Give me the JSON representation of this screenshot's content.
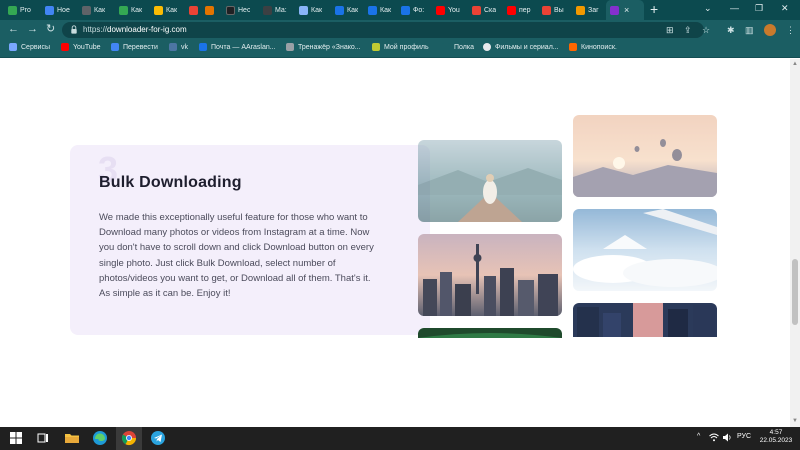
{
  "browser": {
    "tabs": [
      {
        "label": "Pro",
        "color": "#34a853"
      },
      {
        "label": "Hoe",
        "color": "#4285f4"
      },
      {
        "label": "Как",
        "color": "#5f6368"
      },
      {
        "label": "Как",
        "color": "#34a853"
      },
      {
        "label": "Как",
        "color": "#fbbc04"
      },
      {
        "label": "",
        "color": "#ea4335"
      },
      {
        "label": "",
        "color": "#e37400"
      },
      {
        "label": "Hec",
        "color": "#202124"
      },
      {
        "label": "Ма:",
        "color": "#3c4043"
      },
      {
        "label": "Как",
        "color": "#8ab4f8"
      },
      {
        "label": "Как",
        "color": "#1a73e8"
      },
      {
        "label": "Как",
        "color": "#1a73e8"
      },
      {
        "label": "Фо:",
        "color": "#1a73e8"
      },
      {
        "label": "You",
        "color": "#ff0000"
      },
      {
        "label": "Ска",
        "color": "#ea4335"
      },
      {
        "label": "пер",
        "color": "#ff0000"
      },
      {
        "label": "Вы",
        "color": "#ea4335"
      },
      {
        "label": "Заг",
        "color": "#f29900"
      },
      {
        "label": "",
        "color": "#8430ce"
      }
    ],
    "active_tab_close": "×",
    "new_tab": "+",
    "window_buttons": {
      "chevron": "⌄",
      "minimize": "—",
      "restore": "❐",
      "close": "✕"
    },
    "url_prefix": "https://",
    "url_domain": "downloader-for-ig.com",
    "nav": {
      "back": "←",
      "forward": "→",
      "reload": "↻"
    },
    "toolbar_icons": {
      "translate": "⊞",
      "share": "⇪",
      "star": "☆",
      "extensions": "✱",
      "sidebar": "▥",
      "menu": "⋮"
    }
  },
  "bookmarks": [
    {
      "label": "Сервисы",
      "color": "#7aa7ff"
    },
    {
      "label": "YouTube",
      "color": "#ff0000"
    },
    {
      "label": "Перевести",
      "color": "#4285f4"
    },
    {
      "label": "vk",
      "color": "#4c75a3"
    },
    {
      "label": "Почта — AAraslan...",
      "color": "#1a73e8"
    },
    {
      "label": "Тренажёр «Знако...",
      "color": "#9aa0a6"
    },
    {
      "label": "Мой профиль",
      "color": "#c0ca33"
    },
    {
      "label": "Полка",
      "color": "#1b5e63"
    },
    {
      "label": "Фильмы и сериал...",
      "color": "#e8eaed"
    },
    {
      "label": "Кинопоиск.",
      "color": "#ff6600"
    }
  ],
  "feature": {
    "step": "3",
    "title": "Bulk Downloading",
    "description": "We made this exceptionally useful feature for those who want to Download many photos or videos from Instagram at a time. Now you don't have to scroll down and click Download button on every single photo. Just click Bulk Download, select number of photos/videos you want to get, or Download all of them. That's it. As simple as it can be. Enjoy it!"
  },
  "photos": [
    {
      "subject": "girl-in-boat"
    },
    {
      "subject": "city-skyline-tower"
    },
    {
      "subject": "green-aurora"
    },
    {
      "subject": "hot-air-balloons"
    },
    {
      "subject": "plane-wing-over-clouds"
    },
    {
      "subject": "city-buildings-sunset"
    }
  ],
  "taskbar": {
    "tray_chevron": "^",
    "language": "РУС",
    "time": "4:57",
    "date": "22.05.2023"
  }
}
